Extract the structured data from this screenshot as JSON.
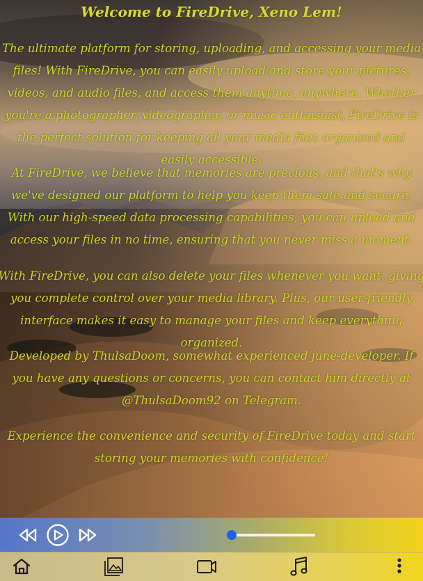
{
  "welcome": {
    "title": "Welcome to FireDrive, Xeno Lem!",
    "paragraphs": [
      "The ultimate platform for storing, uploading, and accessing your media files! With FireDrive, you can easily upload and store your pictures, videos, and audio files, and access them anytime, anywhere. Whether you're a photographer, videographer, or music enthusiast, FireDrive is the perfect solution for keeping all your media files organized and easily accessible.",
      "At FireDrive, we believe that memories are precious, and that's why we've designed our platform to help you keep them safe and secure. With our high-speed data processing capabilities, you can upload and access your files in no time, ensuring that you never miss a moment.",
      "With FireDrive, you can also delete your files whenever you want, giving you complete control over your media library. Plus, our user-friendly interface makes it easy to manage your files and keep everything organized.",
      "Developed by ThulsaDoom, somewhat experienced june-developer. If you have any questions or concerns, you can contact him directly at @ThulsaDoom92 on Telegram.",
      "Experience the convenience and security of FireDrive today and start storing your memories with confidence!"
    ]
  },
  "player": {
    "controls": [
      "rewind-icon",
      "play-icon",
      "fast-forward-icon"
    ],
    "progress": 0.0,
    "accent": "#1b63e6"
  },
  "nav": {
    "items": [
      "home-icon",
      "gallery-icon",
      "video-icon",
      "music-icon",
      "more-vertical-icon"
    ]
  },
  "colors": {
    "text": "#c8d62a"
  }
}
